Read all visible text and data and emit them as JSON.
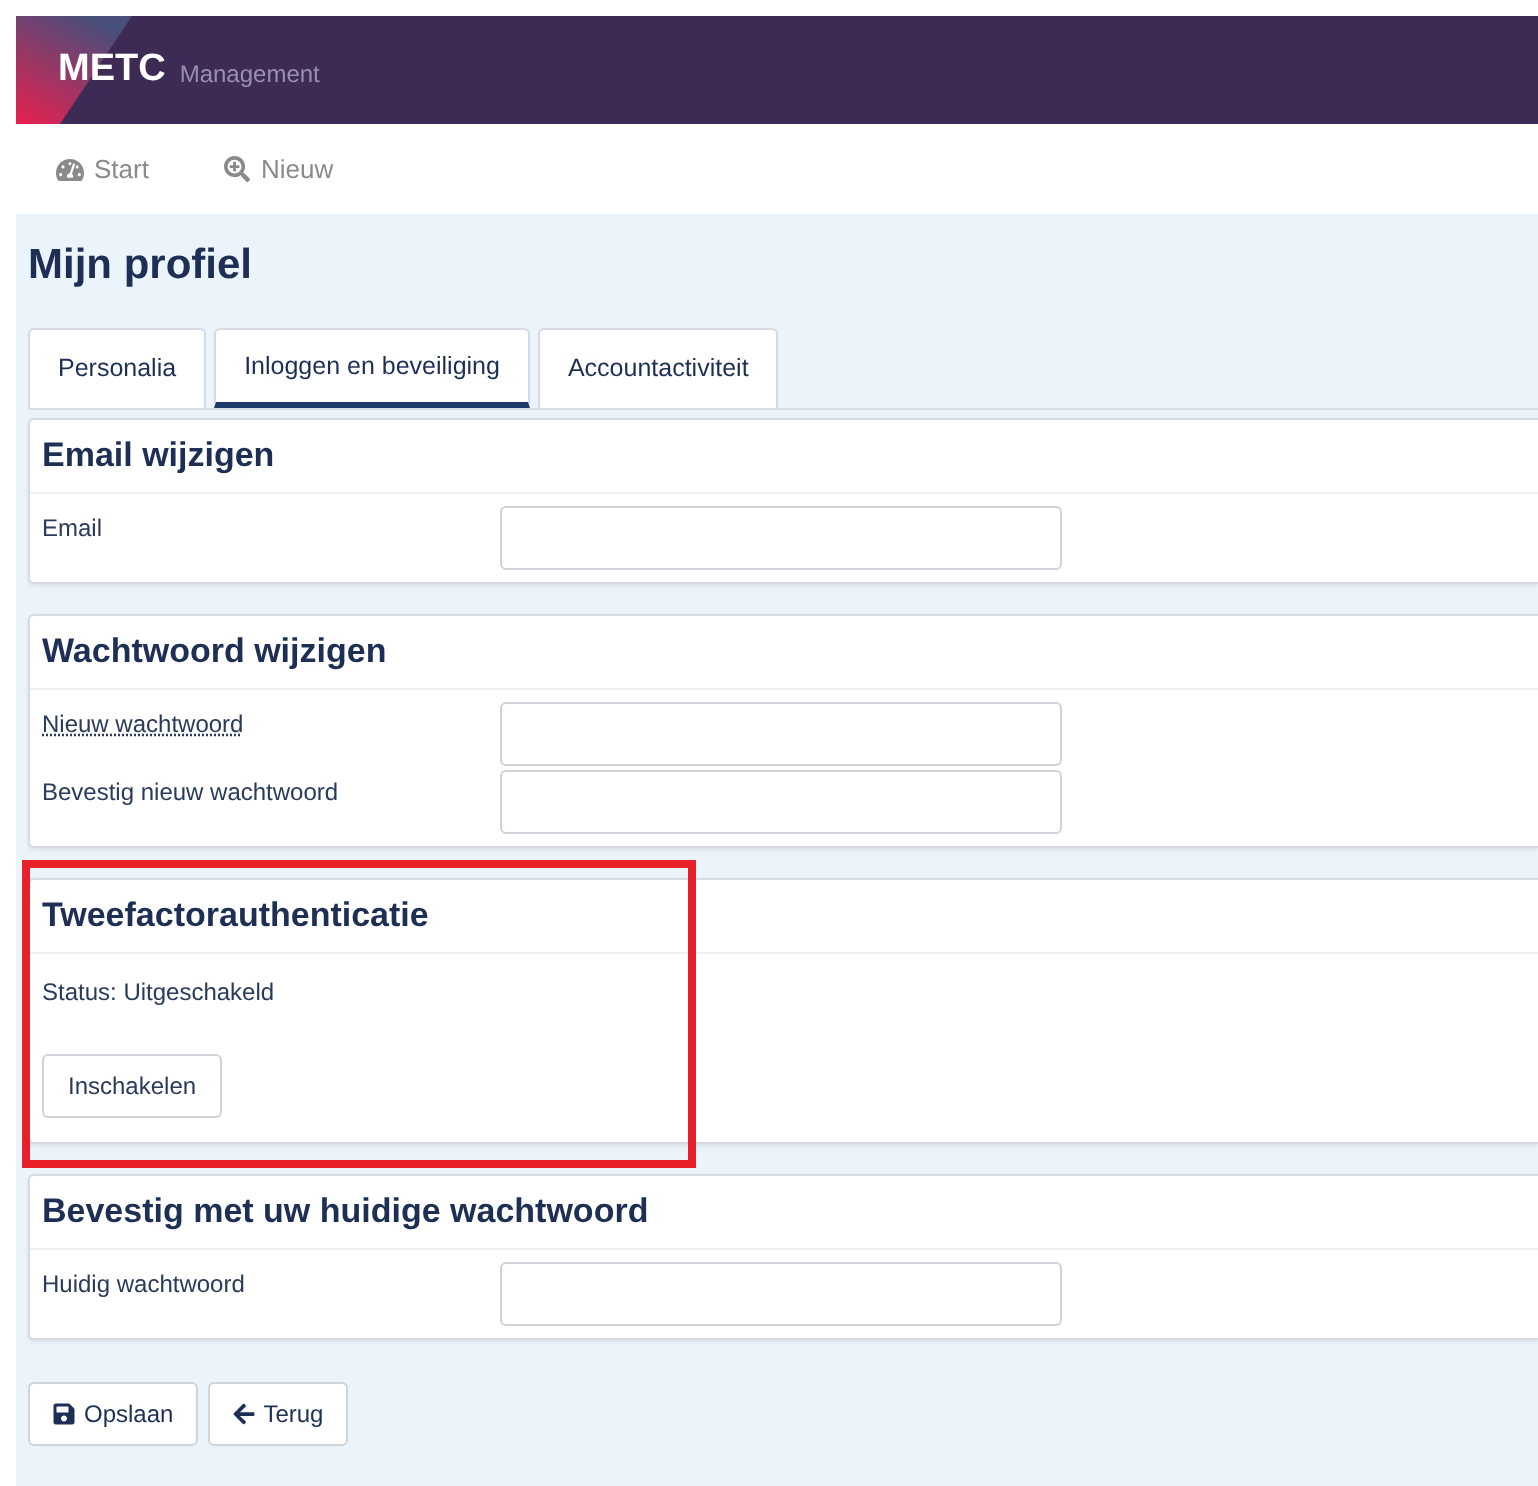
{
  "header": {
    "brand": "METC",
    "product": "Management"
  },
  "nav": [
    {
      "kind": "dashboard",
      "label": "Start"
    },
    {
      "kind": "search",
      "label": "Nieuw"
    }
  ],
  "page_title": "Mijn profiel",
  "tabs": [
    {
      "label": "Personalia",
      "selected": false
    },
    {
      "label": "Inloggen en beveiliging",
      "selected": true
    },
    {
      "label": "Accountactiviteit",
      "selected": false
    }
  ],
  "sections": [
    {
      "title": "Email wijzigen",
      "highlighted": false,
      "fields": [
        {
          "label": "Email",
          "dotted_underline": false
        }
      ]
    },
    {
      "title": "Wachtwoord wijzigen",
      "highlighted": false,
      "fields": [
        {
          "label": "Nieuw wachtwoord",
          "dotted_underline": true
        },
        {
          "label": "Bevestig nieuw wachtwoord",
          "dotted_underline": false
        }
      ]
    },
    {
      "title": "Tweefactorauthenticatie",
      "highlighted": true,
      "status": "Status: Uitgeschakeld",
      "button": "Inschakelen"
    },
    {
      "title": "Bevestig met uw huidige wachtwoord",
      "highlighted": false,
      "fields": [
        {
          "label": "Huidig wachtwoord",
          "dotted_underline": false
        }
      ]
    }
  ],
  "actions": [
    {
      "kind": "save",
      "label": "Opslaan"
    },
    {
      "kind": "back",
      "label": "Terug"
    }
  ]
}
